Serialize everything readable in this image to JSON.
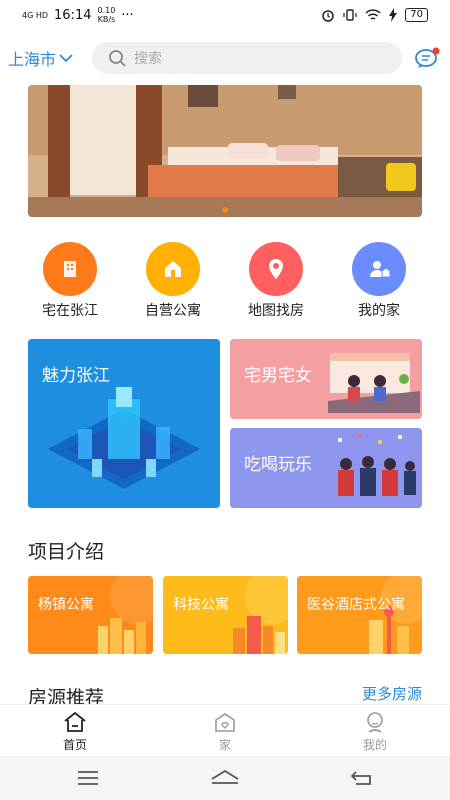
{
  "status": {
    "network": "4G HD",
    "time": "16:14",
    "speed_value": "0.10",
    "speed_unit": "KB/s",
    "dots": "···",
    "battery": "70"
  },
  "header": {
    "city": "上海市",
    "search_placeholder": "搜索"
  },
  "quick_links": [
    {
      "label": "宅在张江",
      "color": "#ff7a1a",
      "icon": "building-icon"
    },
    {
      "label": "自营公寓",
      "color": "#ffb000",
      "icon": "house-icon"
    },
    {
      "label": "地图找房",
      "color": "#ff5f5f",
      "icon": "map-pin-icon"
    },
    {
      "label": "我的家",
      "color": "#6a8cff",
      "icon": "person-home-icon"
    }
  ],
  "tiles": {
    "charm": {
      "label": "魅力张江",
      "color": "#1e8fe0"
    },
    "otaku": {
      "label": "宅男宅女",
      "color": "#f4a0a3"
    },
    "fun": {
      "label": "吃喝玩乐",
      "color": "#8f96ee"
    }
  },
  "projects": {
    "title": "项目介绍",
    "items": [
      {
        "label": "杨镇公寓",
        "color": "#ff8a1a"
      },
      {
        "label": "科技公寓",
        "color": "#ffbb1a"
      },
      {
        "label": "医谷酒店式公寓",
        "color": "#ff9a1a"
      }
    ]
  },
  "listings": {
    "title": "房源推荐",
    "more": "更多房源"
  },
  "tabs": [
    {
      "label": "首页",
      "icon": "home-icon",
      "active": true
    },
    {
      "label": "家",
      "icon": "heart-house-icon",
      "active": false
    },
    {
      "label": "我的",
      "icon": "user-icon",
      "active": false
    }
  ],
  "colors": {
    "accent": "#2a8bd8",
    "inactive": "#999999"
  }
}
